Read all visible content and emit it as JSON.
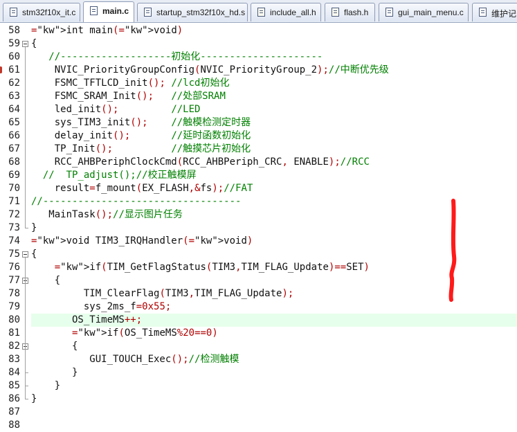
{
  "tabs": [
    {
      "label": "stm32f10x_it.c",
      "active": false,
      "icon": "c-file-icon"
    },
    {
      "label": "main.c",
      "active": true,
      "icon": "c-file-icon"
    },
    {
      "label": "startup_stm32f10x_hd.s",
      "active": false,
      "icon": "asm-file-icon"
    },
    {
      "label": "include_all.h",
      "active": false,
      "icon": "h-file-icon"
    },
    {
      "label": "flash.h",
      "active": false,
      "icon": "h-file-icon"
    },
    {
      "label": "gui_main_menu.c",
      "active": false,
      "icon": "c-file-icon"
    },
    {
      "label": "维护记录",
      "active": false,
      "icon": "c-file-icon"
    }
  ],
  "editor": {
    "highlight_line": 80,
    "breakpoint_line": 61,
    "lines": [
      {
        "n": "58",
        "text": "int main(void)"
      },
      {
        "n": "59",
        "text": "{"
      },
      {
        "n": "60",
        "text": "   //-------------------初始化---------------------"
      },
      {
        "n": "61",
        "text": "    NVIC_PriorityGroupConfig(NVIC_PriorityGroup_2);//中断优先级"
      },
      {
        "n": "62",
        "text": "    FSMC_TFTLCD_init(); //lcd初始化"
      },
      {
        "n": "63",
        "text": "    FSMC_SRAM_Init();   //处部SRAM"
      },
      {
        "n": "64",
        "text": "    led_init();         //LED"
      },
      {
        "n": "65",
        "text": "    sys_TIM3_init();    //触模检测定时器"
      },
      {
        "n": "66",
        "text": "    delay_init();       //延时函数初始化"
      },
      {
        "n": "67",
        "text": "    TP_Init();          //触摸芯片初始化"
      },
      {
        "n": "68",
        "text": "    RCC_AHBPeriphClockCmd(RCC_AHBPeriph_CRC, ENABLE);//RCC"
      },
      {
        "n": "69",
        "text": "  //  TP_adjust();//校正触模屏"
      },
      {
        "n": "70",
        "text": "    result=f_mount(EX_FLASH,&fs);//FAT"
      },
      {
        "n": "71",
        "text": "//----------------------------------"
      },
      {
        "n": "72",
        "text": "   MainTask();//显示图片任务"
      },
      {
        "n": "73",
        "text": "}"
      },
      {
        "n": "74",
        "text": "void TIM3_IRQHandler(void)"
      },
      {
        "n": "75",
        "text": "{"
      },
      {
        "n": "76",
        "text": "    if(TIM_GetFlagStatus(TIM3,TIM_FLAG_Update)==SET)"
      },
      {
        "n": "77",
        "text": "    {"
      },
      {
        "n": "78",
        "text": "         TIM_ClearFlag(TIM3,TIM_FLAG_Update);"
      },
      {
        "n": "79",
        "text": "         sys_2ms_f=0x55;"
      },
      {
        "n": "80",
        "text": "       OS_TimeMS++;"
      },
      {
        "n": "81",
        "text": "       if(OS_TimeMS%20==0)"
      },
      {
        "n": "82",
        "text": "       {"
      },
      {
        "n": "83",
        "text": "          GUI_TOUCH_Exec();//检测触模"
      },
      {
        "n": "84",
        "text": "       }"
      },
      {
        "n": "85",
        "text": "    }"
      },
      {
        "n": "86",
        "text": "}"
      },
      {
        "n": "87",
        "text": ""
      },
      {
        "n": "88",
        "text": ""
      }
    ]
  },
  "annotation": {
    "color": "#ff1a1a",
    "icon": "red-pen-mark"
  }
}
